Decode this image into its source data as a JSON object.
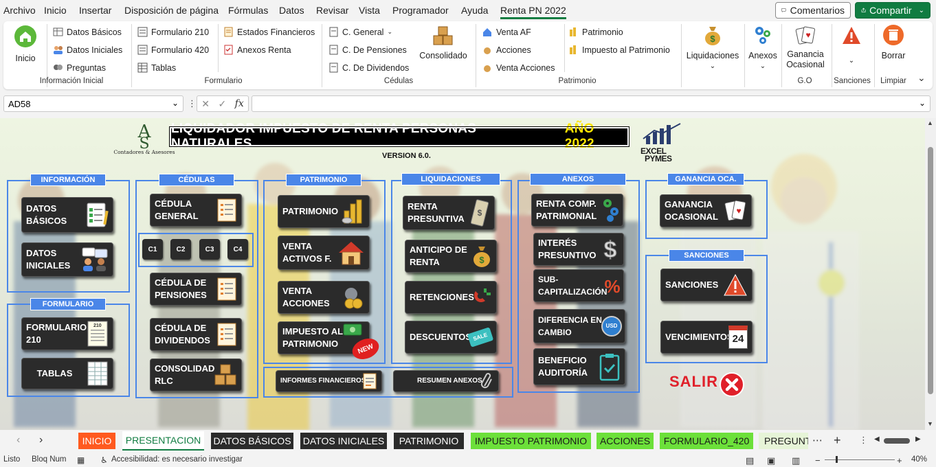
{
  "menu": [
    "Archivo",
    "Inicio",
    "Insertar",
    "Disposición de página",
    "Fórmulas",
    "Datos",
    "Revisar",
    "Vista",
    "Programador",
    "Ayuda",
    "Renta PN 2022"
  ],
  "top_buttons": {
    "comments": "Comentarios",
    "share": "Compartir"
  },
  "ribbon": {
    "inicio": "Inicio",
    "info": [
      "Datos Básicos",
      "Datos Iniciales",
      "Preguntas"
    ],
    "info_label": "Información Inicial",
    "form_col1": [
      "Formulario 210",
      "Formulario 420",
      "Tablas"
    ],
    "form_col2": [
      "Estados Financieros",
      "Anexos Renta"
    ],
    "form_label": "Formulario",
    "cedulas": [
      "C. General",
      "C. De Pensiones",
      "C. De Dividendos"
    ],
    "consolidado": "Consolidado",
    "cedulas_label": "Cédulas",
    "patr_col1": [
      "Venta AF",
      "Acciones",
      "Venta Acciones"
    ],
    "patr_col2": [
      "Patrimonio",
      "Impuesto al Patrimonio"
    ],
    "patr_label": "Patrimonio",
    "liquidaciones": "Liquidaciones",
    "anexos": "Anexos",
    "ganancia": "Ganancia Ocasional",
    "go_label": "G.O",
    "sanciones_label": "Sanciones",
    "borrar": "Borrar",
    "limpiar_label": "Limpiar"
  },
  "namebox": "AD58",
  "sheet": {
    "logo_text": "Contadores & Asesores",
    "excel_logo": [
      "EXCEL",
      "PYMES"
    ],
    "title": "LIQUIDADOR IMPUESTO DE RENTA PERSONAS NATURALES",
    "title_year": "AÑO 2022",
    "version": "VERSION 6.0.",
    "sections": {
      "informacion": "INFORMACIÓN",
      "formulario": "FORMULARIO",
      "cedulas": "CÉDULAS",
      "patrimonio": "PATRIMONIO",
      "liquidaciones": "LIQUIDACIONES",
      "anexos": "ANEXOS",
      "ganancia": "GANANCIA OCA.",
      "sanciones": "SANCIONES"
    },
    "tiles": {
      "datos_basicos": [
        "DATOS",
        "BÁSICOS"
      ],
      "datos_iniciales": [
        "DATOS",
        "INICIALES"
      ],
      "formulario_210": [
        "FORMULARIO",
        "210"
      ],
      "tablas": "TABLAS",
      "cedula_general": [
        "CÉDULA",
        "GENERAL"
      ],
      "c_buttons": [
        "C1",
        "C2",
        "C3",
        "C4"
      ],
      "cedula_pensiones": [
        "CÉDULA DE",
        "PENSIONES"
      ],
      "cedula_dividendos": [
        "CÉDULA DE",
        "DIVIDENDOS"
      ],
      "consolidado_rlc": [
        "CONSOLIDADO",
        "RLC"
      ],
      "patrimonio": "PATRIMONIO",
      "venta_activos": [
        "VENTA",
        "ACTIVOS F."
      ],
      "venta_acciones": [
        "VENTA",
        "ACCIONES"
      ],
      "impuesto_patrimonio": [
        "IMPUESTO AL",
        "PATRIMONIO"
      ],
      "new_badge": "NEW",
      "renta_presuntiva": [
        "RENTA",
        "PRESUNTIVA"
      ],
      "anticipo_renta": [
        "ANTICIPO DE",
        "RENTA"
      ],
      "retenciones": "RETENCIONES",
      "descuentos": "DESCUENTOS",
      "sale_badge": "SALE",
      "renta_comp": [
        "RENTA COMP.",
        "PATRIMONIAL"
      ],
      "interes_presuntivo": [
        "INTERÉS",
        "PRESUNTIVO"
      ],
      "subcapitalizacion": [
        "SUB-",
        "CAPITALIZACIÓN"
      ],
      "diferencia_cambio": [
        "DIFERENCIA EN",
        "CAMBIO"
      ],
      "usd": "USD",
      "beneficio_auditoria": [
        "BENEFICIO",
        "AUDITORÍA"
      ],
      "ganancia_ocasional": [
        "GANANCIA",
        "OCASIONAL"
      ],
      "sanciones": "SANCIONES",
      "vencimientos": "VENCIMIENTOS",
      "calendar_day": "24",
      "informes_financieros": "INFORMES FINANCIEROS",
      "resumen_anexos": "RESUMEN ANEXOS",
      "form_icon_num": "210"
    },
    "salir": "SALIR"
  },
  "sheet_tabs": [
    {
      "label": "INICIO",
      "bg": "#ff5a1f",
      "fg": "#ffffff"
    },
    {
      "label": "PRESENTACION",
      "bg": "#ffffff",
      "fg": "#107c41"
    },
    {
      "label": "DATOS BÁSICOS",
      "bg": "#2b2b2b",
      "fg": "#ffffff"
    },
    {
      "label": "DATOS INICIALES",
      "bg": "#2b2b2b",
      "fg": "#ffffff"
    },
    {
      "label": "PATRIMONIO",
      "bg": "#2b2b2b",
      "fg": "#ffffff"
    },
    {
      "label": "IMPUESTO PATRIMONIO",
      "bg": "#6ce03a",
      "fg": "#1a1a1a"
    },
    {
      "label": "ACCIONES",
      "bg": "#6ce03a",
      "fg": "#1a1a1a"
    },
    {
      "label": "FORMULARIO_420",
      "bg": "#6ce03a",
      "fg": "#1a1a1a"
    },
    {
      "label": "PREGUNT",
      "bg": "#e6f4d7",
      "fg": "#1a1a1a"
    }
  ],
  "status": {
    "ready": "Listo",
    "numlock": "Bloq Num",
    "accessibility": "Accesibilidad: es necesario investigar",
    "zoom": "40%"
  },
  "colors": {
    "accent": "#107c41",
    "section_blue": "#4a86e8",
    "tile_dark": "#2b2b2b",
    "title_yellow": "#ffe500",
    "salir_red": "#e0202a"
  }
}
